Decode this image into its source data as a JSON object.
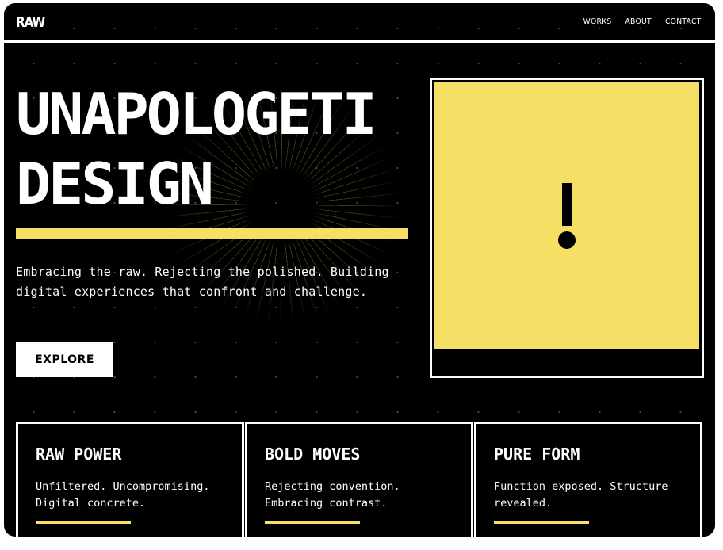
{
  "header": {
    "logo": "RAW",
    "nav": [
      {
        "label": "WORKS"
      },
      {
        "label": "ABOUT"
      },
      {
        "label": "CONTACT"
      }
    ]
  },
  "hero": {
    "title_line1": "UNAPOLOGETI",
    "title_line2": "DESIGN",
    "description": "Embracing the raw. Rejecting the polished. Building digital experiences that confront and challenge.",
    "cta_label": "EXPLORE"
  },
  "panel": {
    "symbol": "!",
    "color": "#f5df64"
  },
  "cards": [
    {
      "title": "RAW POWER",
      "text": "Unfiltered. Uncompromising. Digital concrete."
    },
    {
      "title": "BOLD MOVES",
      "text": "Rejecting convention. Embracing contrast."
    },
    {
      "title": "PURE FORM",
      "text": "Function exposed. Structure revealed."
    }
  ],
  "colors": {
    "background": "#000000",
    "accent": "#f5df64",
    "text": "#ffffff"
  }
}
